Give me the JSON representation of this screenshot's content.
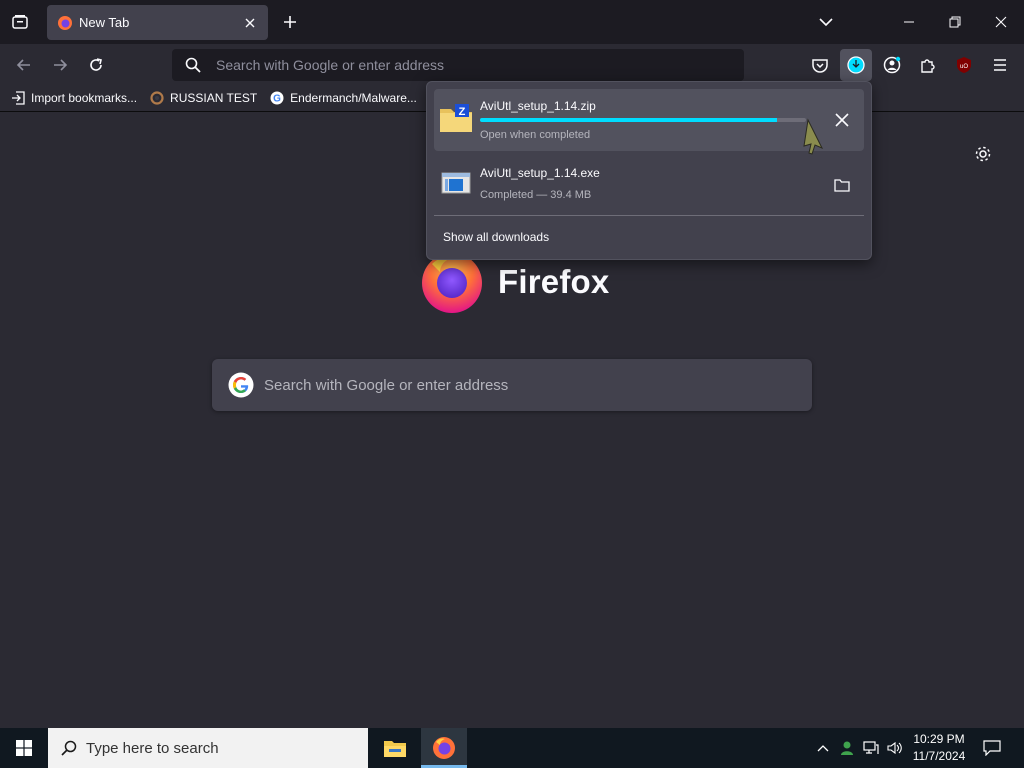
{
  "browser": {
    "tab": {
      "title": "New Tab"
    },
    "urlbar": {
      "placeholder": "Search with Google or enter address"
    },
    "bookmarks": [
      {
        "label": "Import bookmarks...",
        "icon": "import-icon"
      },
      {
        "label": "RUSSIAN TEST",
        "icon": "site-icon"
      },
      {
        "label": "Endermanch/Malware...",
        "icon": "google-icon"
      }
    ]
  },
  "downloads": {
    "items": [
      {
        "name": "AviUtl_setup_1.14.zip",
        "status": "Open when completed",
        "progress": 0.91,
        "icon": "zip-archive-icon",
        "action": "cancel"
      },
      {
        "name": "AviUtl_setup_1.14.exe",
        "status": "Completed — 39.4 MB",
        "icon": "installer-icon",
        "action": "show-in-folder"
      }
    ],
    "show_all": "Show all downloads"
  },
  "newtab": {
    "logo_text": "Firefox",
    "search_placeholder": "Search with Google or enter address"
  },
  "taskbar": {
    "search_placeholder": "Type here to search",
    "time": "10:29 PM",
    "date": "11/7/2024"
  },
  "colors": {
    "accent": "#00ddff",
    "toolbar": "#2b2a33",
    "tabstrip": "#1c1b22",
    "panel": "#42414d"
  }
}
